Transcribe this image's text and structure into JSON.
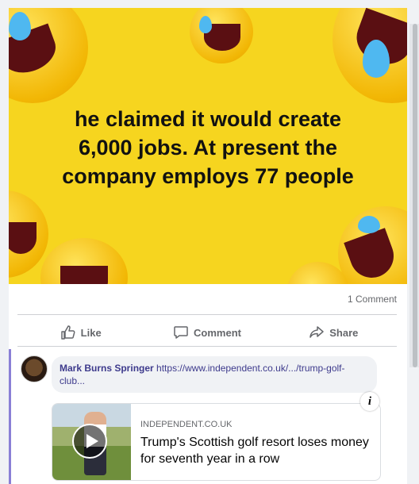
{
  "meme": {
    "lines": [
      "he claimed it would create",
      "6,000 jobs. At present the",
      "company employs 77 people"
    ]
  },
  "post": {
    "comment_count": "1 Comment",
    "actions": {
      "like": "Like",
      "comment": "Comment",
      "share": "Share"
    }
  },
  "comment": {
    "author": "Mark Burns Springer",
    "text": "https://www.independent.co.uk/.../trump-golf-club..."
  },
  "link_preview": {
    "source": "INDEPENDENT.CO.UK",
    "headline": "Trump's Scottish golf resort loses money for seventh year in a row"
  }
}
